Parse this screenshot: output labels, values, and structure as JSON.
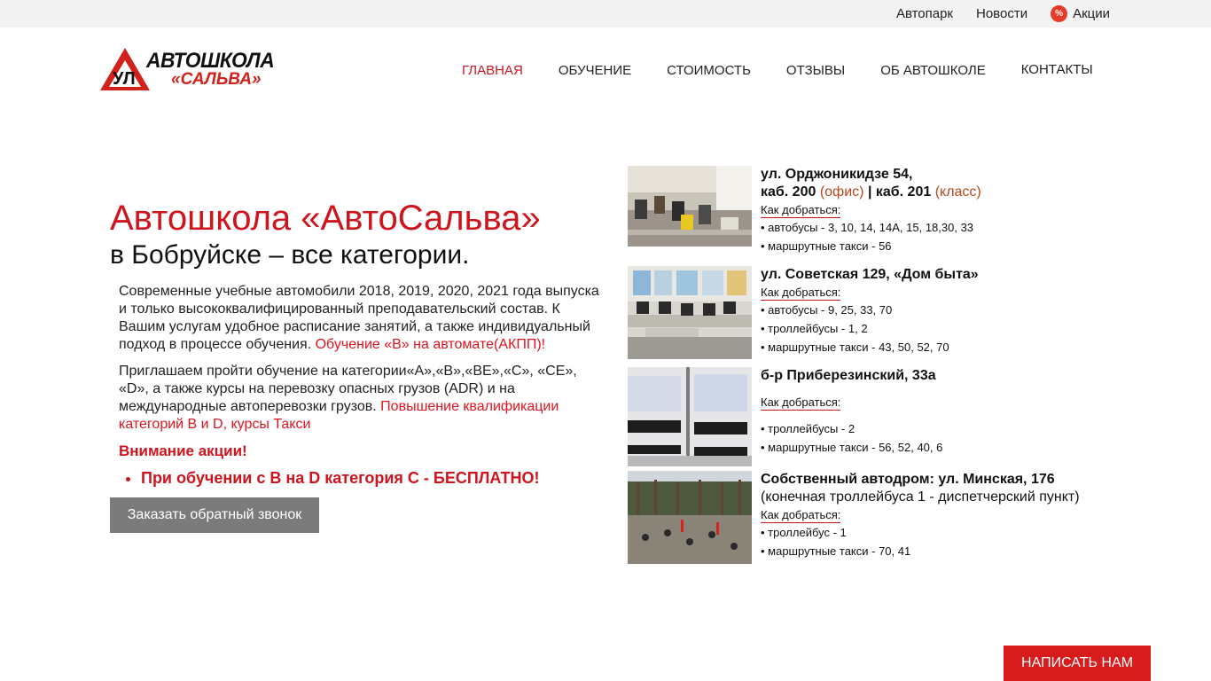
{
  "topbar": {
    "links": [
      "Автопарк",
      "Новости",
      "Акции"
    ]
  },
  "logo": {
    "line1": "АВТОШКОЛА",
    "line2": "«САЛЬВА»",
    "sign_letters": "УЛ"
  },
  "nav": {
    "items": [
      "ГЛАВНАЯ",
      "ОБУЧЕНИЕ",
      "СТОИМОСТЬ",
      "ОТЗЫВЫ",
      "ОБ АВТОШКОЛЕ",
      "КОНТАКТЫ"
    ],
    "active": "ГЛАВНАЯ"
  },
  "hero": {
    "title": "Автошкола «АвтоСальва»",
    "subtitle": "в Бобруйске – все категории."
  },
  "description": {
    "p1": "Современные учебные автомобили 2018, 2019, 2020, 2021 года выпуска и только высококвалифицированный преподавательский состав. К Вашим услугам удобное расписание занятий, а также индивидуальный подход в процессе обучения.",
    "p1_link": "Обучение «B»  на автомате(АКПП)!",
    "p2": "Приглашаем пройти обучение на категории«A»,«B»,«BE»,«C», «CE», «D», а также курсы на перевозку опасных грузов (ADR) и на международные автоперевозки грузов.",
    "p2_link": "Повышение квалификации категорий B и D, курсы Такси",
    "promo_title": "Внимание акции!",
    "promo_items": [
      "При обучении с B на D категория C - БЕСПЛАТНО!"
    ]
  },
  "callback_button": "Заказать обратный звонок",
  "addresses": [
    {
      "title_line1": "ул. Орджоникидзе 54,",
      "title_line2_a": "каб. 200",
      "title_line2_b": "(офис)",
      "title_line2_c": "| каб. 201",
      "title_line2_d": "(класс)",
      "how_label": "Как добраться:",
      "routes": [
        "• автобусы - 3, 10, 14, 14А, 15, 18,30, 33",
        "• маршрутные такси - 56"
      ]
    },
    {
      "title_line1": "ул. Советская 129, «Дом быта»",
      "how_label": "Как добраться:",
      "routes": [
        "• автобусы - 9, 25, 33, 70",
        "• троллейбусы - 1, 2",
        "• маршрутные такси - 43, 50, 52, 70"
      ]
    },
    {
      "title_line1": "б-р Приберезинский, 33а",
      "how_label": "Как добраться:",
      "routes": [
        "• троллейбусы - 2",
        "• маршрутные такси - 56, 52, 40, 6"
      ]
    },
    {
      "title_line1": "Собственный автодром: ул. Минская, 176",
      "title_plain": "(конечная троллейбуса 1 - диспетчерский пункт)",
      "how_label": "Как добраться:",
      "routes": [
        "• троллейбус - 1",
        "• маршрутные такси - 70, 41"
      ]
    }
  ],
  "write_button": "НАПИСАТЬ НАМ",
  "colors": {
    "accent_red": "#d0141e",
    "button_gray": "#7b7b7b",
    "topbar_bg": "#f3f3f3",
    "brown": "#b5471b"
  },
  "icons": {
    "promo": "percent-badge-icon"
  }
}
